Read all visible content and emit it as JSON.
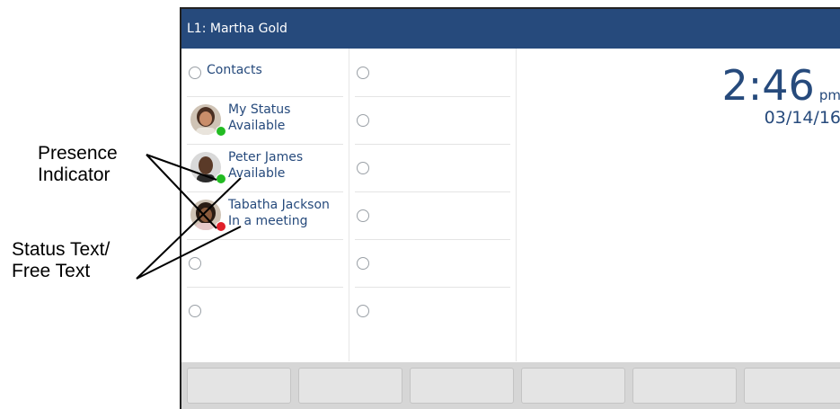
{
  "titlebar": {
    "text": "L1: Martha Gold"
  },
  "left_column": {
    "contacts_label": "Contacts",
    "entries": [
      {
        "name": "My Status",
        "status": "Available",
        "presence": "available"
      },
      {
        "name": "Peter James",
        "status": "Available",
        "presence": "available"
      },
      {
        "name": "Tabatha Jackson",
        "status": "In a meeting",
        "presence": "busy"
      }
    ]
  },
  "clock": {
    "time": "2:46",
    "ampm": "pm",
    "date": "03/14/16"
  },
  "annotations": {
    "presence_line1": "Presence",
    "presence_line2": "Indicator",
    "status_line1": "Status Text/",
    "status_line2": "Free Text"
  },
  "colors": {
    "titlebar": "#264a7c",
    "available": "#22bb22",
    "busy": "#e0202a",
    "text": "#264a7c"
  }
}
